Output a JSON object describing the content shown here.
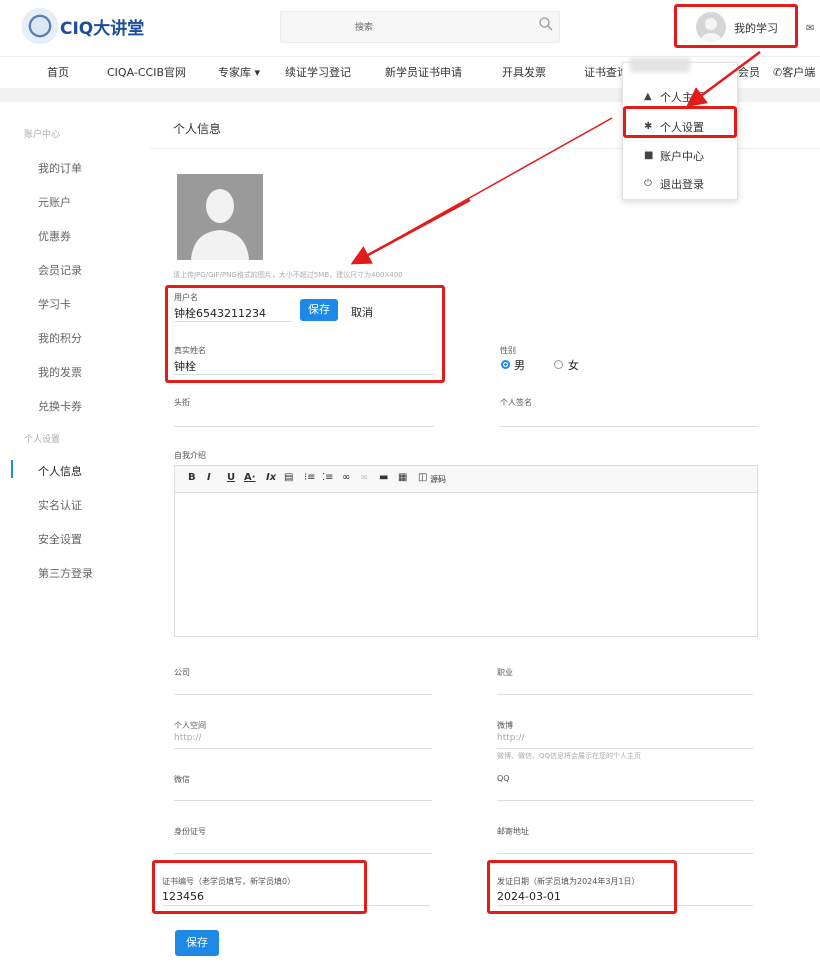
{
  "header": {
    "logo_text": "CIQ大讲堂",
    "search_placeholder": "搜索",
    "user_menu_label": "我的学习"
  },
  "nav": {
    "items": [
      "首页",
      "CIQA-CCIB官网",
      "专家库 ▾",
      "续证学习登记",
      "新学员证书申请",
      "开具发票",
      "证书查询",
      "会员",
      "客户端"
    ]
  },
  "dropdown": {
    "items": [
      {
        "label": "个人主页",
        "icon": "person-icon"
      },
      {
        "label": "个人设置",
        "icon": "gear-icon"
      },
      {
        "label": "账户中心",
        "icon": "wallet-icon"
      },
      {
        "label": "退出登录",
        "icon": "power-icon"
      }
    ]
  },
  "sidebar": {
    "section1": "账户中心",
    "items1": [
      "我的订单",
      "元账户",
      "优惠券",
      "会员记录",
      "学习卡",
      "我的积分",
      "我的发票",
      "兑换卡券"
    ],
    "section2": "个人设置",
    "items2": [
      "个人信息",
      "实名认证",
      "安全设置",
      "第三方登录"
    ]
  },
  "main": {
    "title": "个人信息",
    "upload_hint": "请上传JPG/GIF/PNG格式的图片，大小不超过5MB，建议尺寸为400X400",
    "username": {
      "label": "用户名",
      "value": "钟栓6543211234"
    },
    "save_label": "保存",
    "cancel_label": "取消",
    "realname": {
      "label": "真实姓名",
      "value": "钟栓"
    },
    "gender": {
      "label": "性别",
      "male": "男",
      "female": "女",
      "selected": "男"
    },
    "title_field": {
      "label": "头衔"
    },
    "signature": {
      "label": "个人签名"
    },
    "intro": {
      "label": "自我介绍",
      "source_label": "源码"
    },
    "company": {
      "label": "公司"
    },
    "job": {
      "label": "职业"
    },
    "space": {
      "label": "个人空间",
      "placeholder": "http://"
    },
    "weibo": {
      "label": "微博",
      "placeholder": "http://",
      "hint": "微博、微信、QQ信息将会展示在您的个人主页"
    },
    "wechat": {
      "label": "微信"
    },
    "qq": {
      "label": "QQ"
    },
    "idcard": {
      "label": "身份证号"
    },
    "email": {
      "label": "邮寄地址"
    },
    "cert_no": {
      "label": "证书编号（老学员填写，新学员填0）",
      "value": "123456"
    },
    "issue_date": {
      "label": "发证日期（新学员填为2024年3月1日）",
      "value": "2024-03-01"
    },
    "bottom_save": "保存"
  },
  "colors": {
    "accent": "#1e88e5",
    "annotation": "#e21b1b",
    "brand": "#1c4e9b"
  }
}
